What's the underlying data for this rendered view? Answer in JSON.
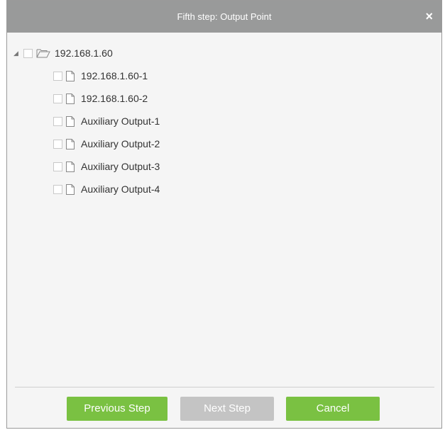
{
  "dialog": {
    "title": "Fifth step: Output Point",
    "close_symbol": "×"
  },
  "tree": {
    "root": {
      "label": "192.168.1.60",
      "expander_symbol": "◢",
      "icon": "folder-open-icon",
      "checked": false
    },
    "children": [
      {
        "label": "192.168.1.60-1",
        "icon": "file-icon",
        "checked": false
      },
      {
        "label": "192.168.1.60-2",
        "icon": "file-icon",
        "checked": false
      },
      {
        "label": "Auxiliary Output-1",
        "icon": "file-icon",
        "checked": false
      },
      {
        "label": "Auxiliary Output-2",
        "icon": "file-icon",
        "checked": false
      },
      {
        "label": "Auxiliary Output-3",
        "icon": "file-icon",
        "checked": false
      },
      {
        "label": "Auxiliary Output-4",
        "icon": "file-icon",
        "checked": false
      }
    ]
  },
  "footer": {
    "previous_label": "Previous Step",
    "next_label": "Next Step",
    "cancel_label": "Cancel"
  },
  "colors": {
    "titlebar": "#999a9a",
    "button_green": "#7ac142",
    "button_disabled": "#c4c4c4"
  }
}
